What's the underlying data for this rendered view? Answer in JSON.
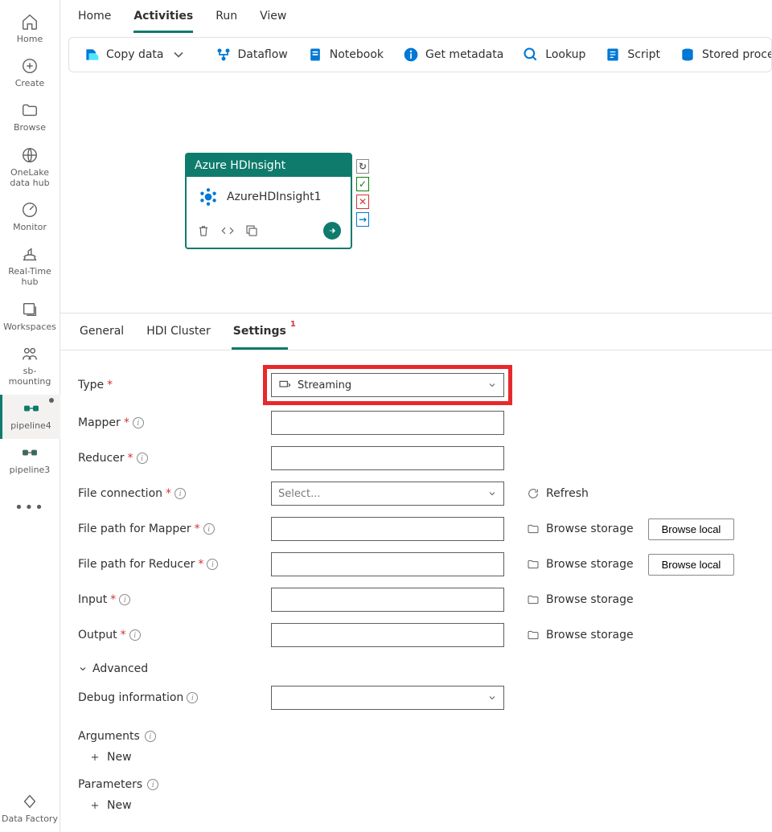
{
  "leftNav": {
    "items": [
      {
        "key": "home",
        "label": "Home",
        "icon": "home"
      },
      {
        "key": "create",
        "label": "Create",
        "icon": "plus-circle"
      },
      {
        "key": "browse",
        "label": "Browse",
        "icon": "folder"
      },
      {
        "key": "onelake",
        "label": "OneLake\ndata hub",
        "icon": "globe"
      },
      {
        "key": "monitor",
        "label": "Monitor",
        "icon": "gauge"
      },
      {
        "key": "realtime",
        "label": "Real-Time\nhub",
        "icon": "ship"
      },
      {
        "key": "workspaces",
        "label": "Workspaces",
        "icon": "stack"
      },
      {
        "key": "sbmounting",
        "label": "sb-\nmounting",
        "icon": "people"
      },
      {
        "key": "pipeline4",
        "label": "pipeline4",
        "icon": "pipeline",
        "active": true,
        "modified": true
      },
      {
        "key": "pipeline3",
        "label": "pipeline3",
        "icon": "pipeline"
      }
    ],
    "moreLabel": "•••",
    "footer": {
      "label": "Data Factory",
      "icon": "datafactory"
    }
  },
  "topMenu": {
    "items": [
      {
        "label": "Home"
      },
      {
        "label": "Activities",
        "active": true
      },
      {
        "label": "Run"
      },
      {
        "label": "View"
      }
    ]
  },
  "toolbar": {
    "items": [
      {
        "key": "copydata",
        "label": "Copy data",
        "hasDropdown": true
      },
      {
        "key": "dataflow",
        "label": "Dataflow"
      },
      {
        "key": "notebook",
        "label": "Notebook"
      },
      {
        "key": "getmetadata",
        "label": "Get metadata"
      },
      {
        "key": "lookup",
        "label": "Lookup"
      },
      {
        "key": "script",
        "label": "Script"
      },
      {
        "key": "storedproc",
        "label": "Stored procedu"
      }
    ]
  },
  "canvasNode": {
    "header": "Azure HDInsight",
    "name": "AzureHDInsight1"
  },
  "panelTabs": [
    {
      "label": "General"
    },
    {
      "label": "HDI Cluster"
    },
    {
      "label": "Settings",
      "active": true,
      "badge": "1"
    }
  ],
  "form": {
    "type": {
      "label": "Type",
      "value": "Streaming"
    },
    "mapper": {
      "label": "Mapper"
    },
    "reducer": {
      "label": "Reducer"
    },
    "fileConnection": {
      "label": "File connection",
      "placeholder": "Select...",
      "refreshLabel": "Refresh"
    },
    "filePathMapper": {
      "label": "File path for Mapper",
      "browseStorage": "Browse storage",
      "browseLocal": "Browse local"
    },
    "filePathReducer": {
      "label": "File path for Reducer",
      "browseStorage": "Browse storage",
      "browseLocal": "Browse local"
    },
    "input": {
      "label": "Input",
      "browseStorage": "Browse storage"
    },
    "output": {
      "label": "Output",
      "browseStorage": "Browse storage"
    },
    "advanced": {
      "label": "Advanced"
    },
    "debugInfo": {
      "label": "Debug information"
    },
    "arguments": {
      "title": "Arguments",
      "newLabel": "New"
    },
    "parameters": {
      "title": "Parameters",
      "newLabel": "New"
    }
  }
}
